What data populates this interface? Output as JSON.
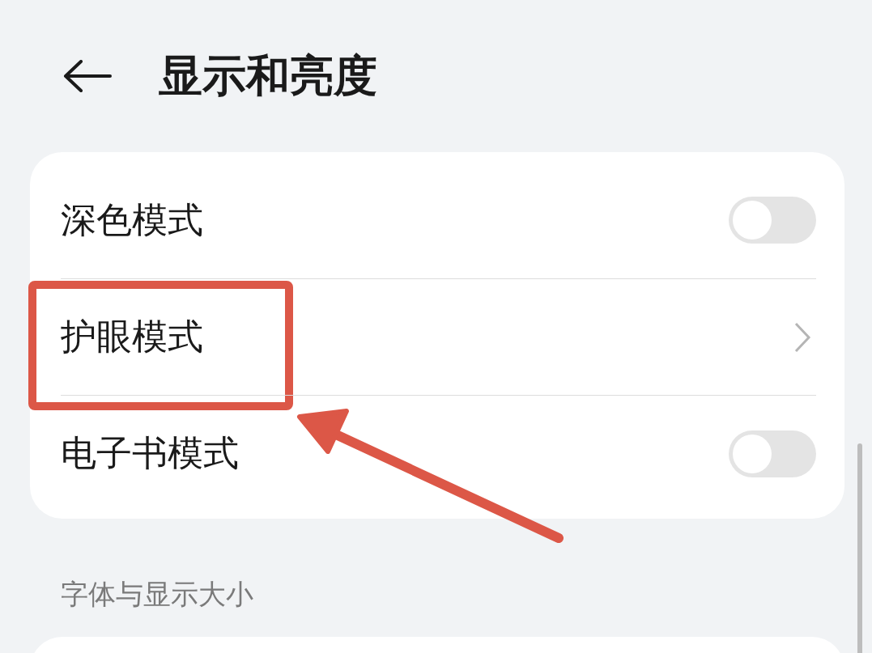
{
  "header": {
    "title": "显示和亮度"
  },
  "settings": [
    {
      "label": "深色模式",
      "kind": "toggle",
      "on": false,
      "highlighted": false
    },
    {
      "label": "护眼模式",
      "kind": "link",
      "highlighted": true
    },
    {
      "label": "电子书模式",
      "kind": "toggle",
      "on": false,
      "highlighted": false
    }
  ],
  "section": {
    "title": "字体与显示大小"
  }
}
